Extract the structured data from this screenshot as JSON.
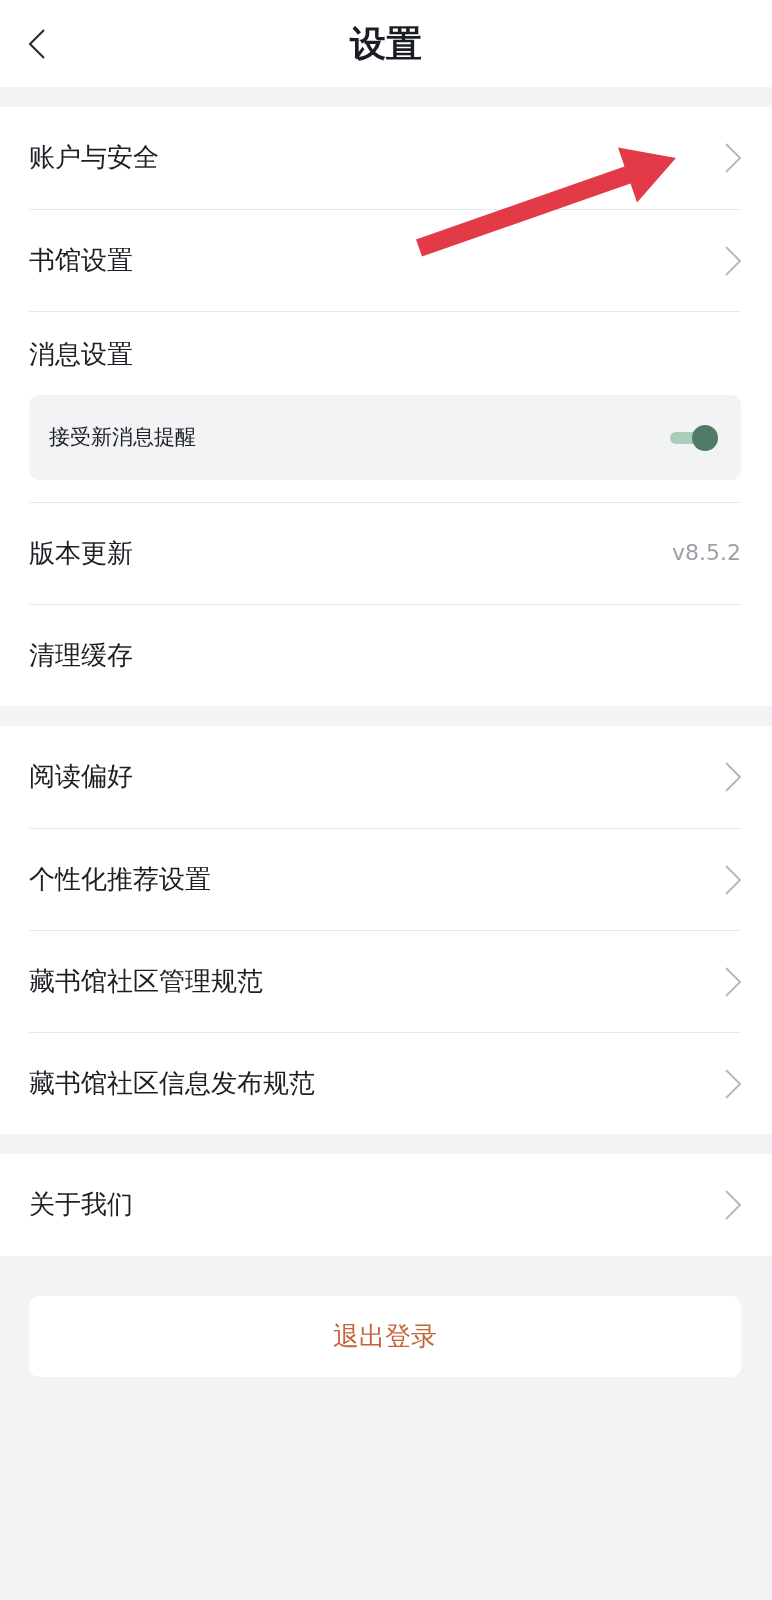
{
  "header": {
    "title": "设置"
  },
  "sections": [
    {
      "items": [
        {
          "kind": "link",
          "label": "账户与安全"
        },
        {
          "kind": "link",
          "label": "书馆设置"
        },
        {
          "kind": "group",
          "label": "消息设置",
          "toggles": [
            {
              "label": "接受新消息提醒",
              "on": true
            }
          ]
        },
        {
          "kind": "value",
          "label": "版本更新",
          "value": "v8.5.2"
        },
        {
          "kind": "plain",
          "label": "清理缓存"
        }
      ]
    },
    {
      "items": [
        {
          "kind": "link",
          "label": "阅读偏好"
        },
        {
          "kind": "link",
          "label": "个性化推荐设置"
        },
        {
          "kind": "link",
          "label": "藏书馆社区管理规范"
        },
        {
          "kind": "link",
          "label": "藏书馆社区信息发布规范"
        }
      ]
    },
    {
      "items": [
        {
          "kind": "link",
          "label": "关于我们"
        }
      ]
    }
  ],
  "logout_button": {
    "label": "退出登录"
  },
  "annotation": {
    "kind": "arrow"
  }
}
